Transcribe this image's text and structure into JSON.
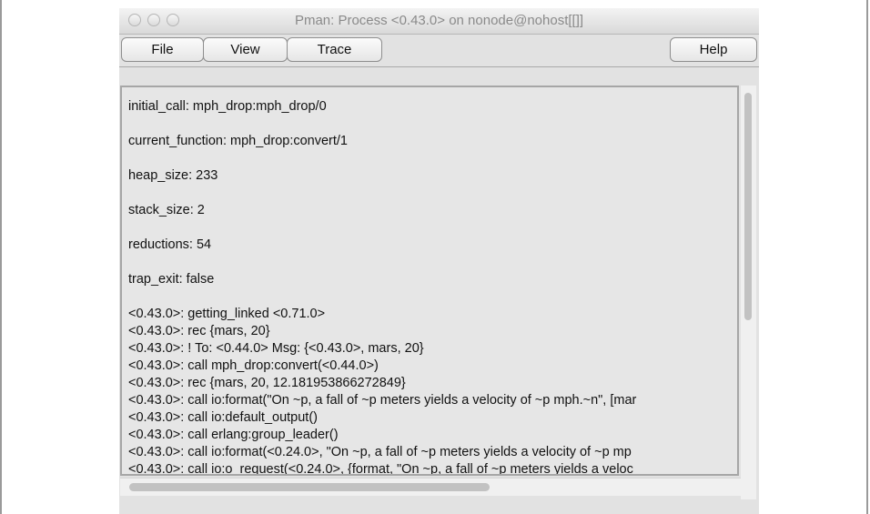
{
  "window": {
    "title": "Pman: Process <0.43.0> on nonode@nohost[[]]"
  },
  "menu": {
    "file": "File",
    "view": "View",
    "trace": "Trace",
    "help": "Help"
  },
  "content": {
    "lines": [
      "initial_call: mph_drop:mph_drop/0",
      "current_function: mph_drop:convert/1",
      "heap_size: 233",
      "stack_size: 2",
      "reductions: 54",
      "trap_exit: false",
      "<0.43.0>: getting_linked   <0.71.0>",
      "<0.43.0>: rec   {mars, 20}",
      "<0.43.0>: !   To: <0.44.0> Msg: {<0.43.0>, mars, 20}",
      "<0.43.0>: call  mph_drop:convert(<0.44.0>)",
      "<0.43.0>: rec   {mars, 20, 12.181953866272849}",
      "<0.43.0>: call  io:format(\"On ~p, a fall of ~p meters yields a velocity of ~p mph.~n\", [mar",
      "<0.43.0>: call  io:default_output()",
      "<0.43.0>: call  erlang:group_leader()",
      "<0.43.0>: call  io:format(<0.24.0>, \"On ~p, a fall of ~p meters yields a velocity of ~p mp",
      "<0.43.0>: call  io:o_request(<0.24.0>, {format, \"On ~p, a fall of ~p meters yields a veloc"
    ]
  },
  "icons": {
    "close": "close-icon",
    "minimize": "minimize-icon",
    "zoom": "zoom-icon"
  }
}
